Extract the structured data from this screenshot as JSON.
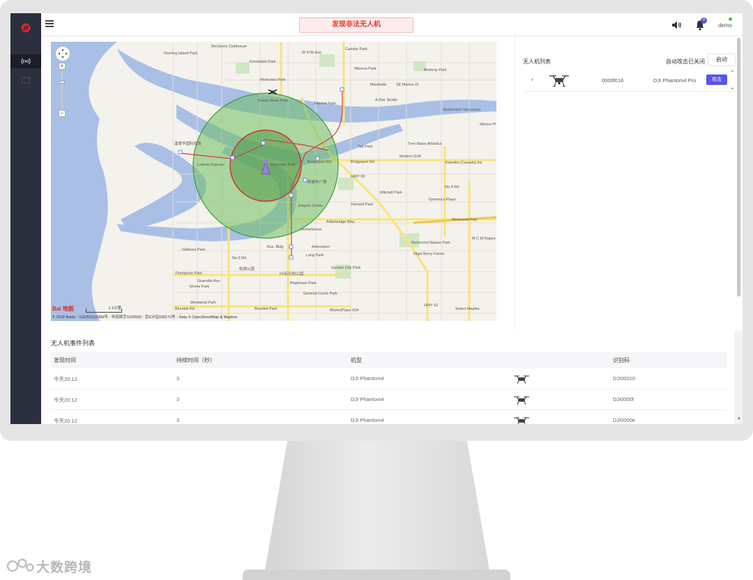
{
  "header": {
    "alert_text": "发现非法无人机",
    "notification_count": "0",
    "username": "demo"
  },
  "map": {
    "logo_text": "Bai 地图",
    "scale_label": "1.1公里",
    "copyright": "© 2018 Baidu - GS(2016)2089号 - 甲测资字1100930 - 京ICP证030173号 - Data © OpenStreetMap & Mapbox",
    "labels": [
      {
        "text": "W 57th Ave"
      },
      {
        "text": "Cambie Park"
      },
      {
        "text": "Deering Island Park"
      },
      {
        "text": "McCleery Clubhouse"
      },
      {
        "text": "Riverview Park"
      },
      {
        "text": "Kerrisdale Park"
      },
      {
        "text": "Winona Park"
      },
      {
        "text": "Moberly Park"
      },
      {
        "text": "Marshalls"
      },
      {
        "text": "SE Marine Dr"
      },
      {
        "text": "Fraser River Park"
      },
      {
        "text": "Eburne Park"
      },
      {
        "text": "A Star Studio"
      },
      {
        "text": "Badminton Vancouver"
      },
      {
        "text": "Wesco Products"
      },
      {
        "text": "温哥华国际机场"
      },
      {
        "text": "Tait Park"
      },
      {
        "text": "Trev-Wave Athletics"
      },
      {
        "text": "Lootnis Express"
      },
      {
        "text": "Modern Golf"
      },
      {
        "text": "Bridgeport Rd"
      },
      {
        "text": "Bridgeport Rd"
      },
      {
        "text": "Riverside Park"
      },
      {
        "text": "Kaimiko (Canada) Inc"
      },
      {
        "text": "新城市广场"
      },
      {
        "text": "Mitchell Park"
      },
      {
        "text": "Gemma's Place"
      },
      {
        "text": "Empire Centre"
      },
      {
        "text": "Tomsett Park"
      },
      {
        "text": "HWY 99"
      },
      {
        "text": "Richmond Fwy"
      },
      {
        "text": "Alderbridge Way"
      },
      {
        "text": "HomeSense"
      },
      {
        "text": "M C M Ropes & Rigging"
      },
      {
        "text": "Richmond Nature Park"
      },
      {
        "text": "Gibbons Park"
      },
      {
        "text": "Bus. Bldg"
      },
      {
        "text": "Arboretum"
      },
      {
        "text": "Nigel Berry Farms"
      },
      {
        "text": "Lang Park"
      },
      {
        "text": "Thompson Park"
      },
      {
        "text": "Garden City Park"
      },
      {
        "text": "桃源公园"
      },
      {
        "text": "FF玩乐的公园"
      },
      {
        "text": "Granville Ave"
      },
      {
        "text": "Brighouse Park"
      },
      {
        "text": "Morris Park"
      },
      {
        "text": "General Currie Park"
      },
      {
        "text": "Westwind Park"
      },
      {
        "text": "Blundell Park"
      },
      {
        "text": "MarketPlace IGA"
      },
      {
        "text": "Select Maples"
      },
      {
        "text": "Blundell Rd"
      },
      {
        "text": "No 3 Rd"
      },
      {
        "text": "No 4 Rd"
      },
      {
        "text": "HWY 91"
      }
    ]
  },
  "drone_list": {
    "title": "无人机列表",
    "auto_label": "自动攻击已关闭",
    "toggle_label": "启动",
    "rows": [
      {
        "expand": "+",
        "id": "0000f016",
        "model": "DJI Phantom4 Pro",
        "action": "攻击"
      }
    ]
  },
  "events": {
    "title": "无人机事件列表",
    "columns": [
      "发现时间",
      "持续时间（秒）",
      "机型",
      "识别码"
    ],
    "rows": [
      {
        "time": "今天20:12",
        "duration": "3",
        "model": "DJI Phantom4",
        "code": "DJI00010"
      },
      {
        "time": "今天20:12",
        "duration": "3",
        "model": "DJI Phantom4",
        "code": "DJI0000f"
      },
      {
        "time": "今天20:12",
        "duration": "3",
        "model": "DJI Phantom4",
        "code": "DJI0000e"
      }
    ]
  },
  "watermark": {
    "text": "大数跨境"
  },
  "colors": {
    "sidebar": "#2b2f3e",
    "alert_text": "#e0392c",
    "accent": "#5b54e6",
    "detection_outer": "#4cae4c",
    "detection_inner": "#d42b2b",
    "water": "#a9bfe6"
  }
}
